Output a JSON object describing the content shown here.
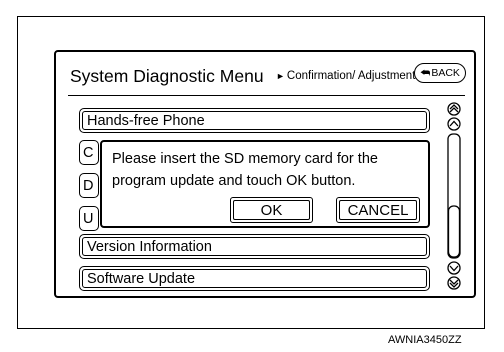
{
  "header": {
    "title": "System Diagnostic Menu",
    "breadcrumb": "Confirmation/ Adjustment",
    "back_label": "BACK"
  },
  "menu": {
    "items": [
      {
        "label": "Hands-free Phone"
      },
      {
        "label": "C"
      },
      {
        "label": "D"
      },
      {
        "label": "U"
      },
      {
        "label": "Version Information"
      },
      {
        "label": "Software Update"
      }
    ]
  },
  "dialog": {
    "message_line1": "Please insert the SD memory card for the",
    "message_line2": "program update and touch OK button.",
    "ok_label": "OK",
    "cancel_label": "CANCEL"
  },
  "scrollbar": {
    "icons": [
      "double-up-icon",
      "up-icon",
      "down-icon",
      "double-down-icon"
    ]
  },
  "figure_id": "AWNIA3450ZZ"
}
